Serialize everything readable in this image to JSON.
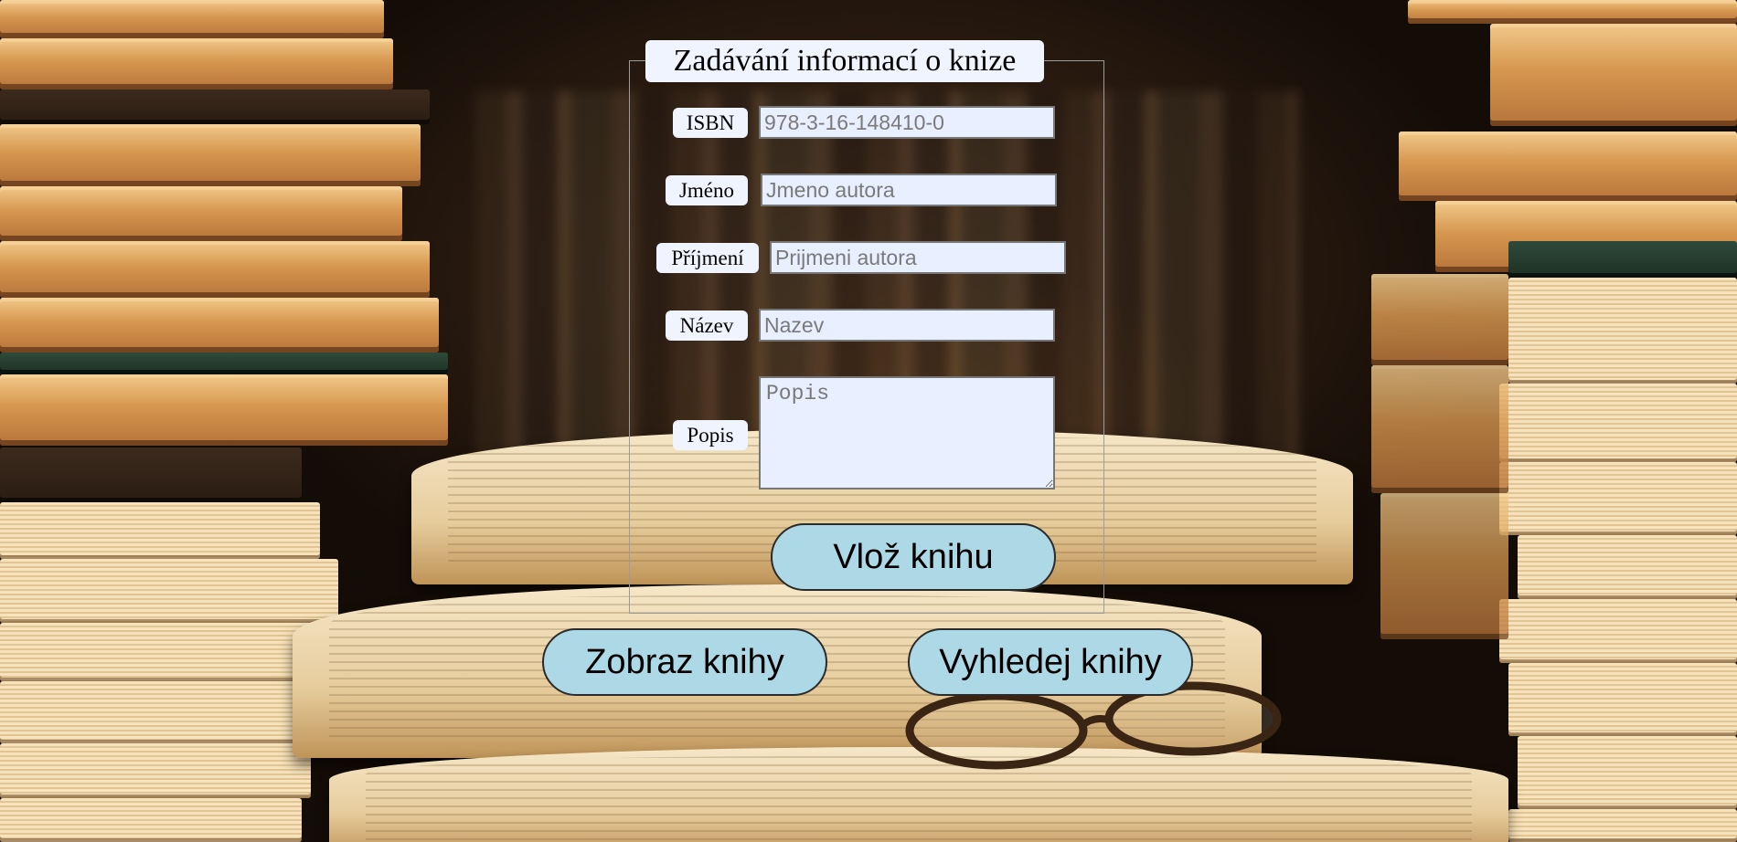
{
  "form": {
    "legend": "Zadávání informací o knize",
    "fields": {
      "isbn": {
        "label": "ISBN",
        "placeholder": "978-3-16-148410-0",
        "value": ""
      },
      "jmeno": {
        "label": "Jméno",
        "placeholder": "Jmeno autora",
        "value": ""
      },
      "prijmeni": {
        "label": "Příjmení",
        "placeholder": "Prijmeni autora",
        "value": ""
      },
      "nazev": {
        "label": "Název",
        "placeholder": "Nazev",
        "value": ""
      },
      "popis": {
        "label": "Popis",
        "placeholder": "Popis",
        "value": ""
      }
    },
    "submit_label": "Vlož knihu"
  },
  "actions": {
    "show_books_label": "Zobraz knihy",
    "search_books_label": "Vyhledej knihy"
  },
  "colors": {
    "button_bg": "#add8e6",
    "label_bg": "#f0f4ff",
    "input_bg": "#e8efff"
  }
}
